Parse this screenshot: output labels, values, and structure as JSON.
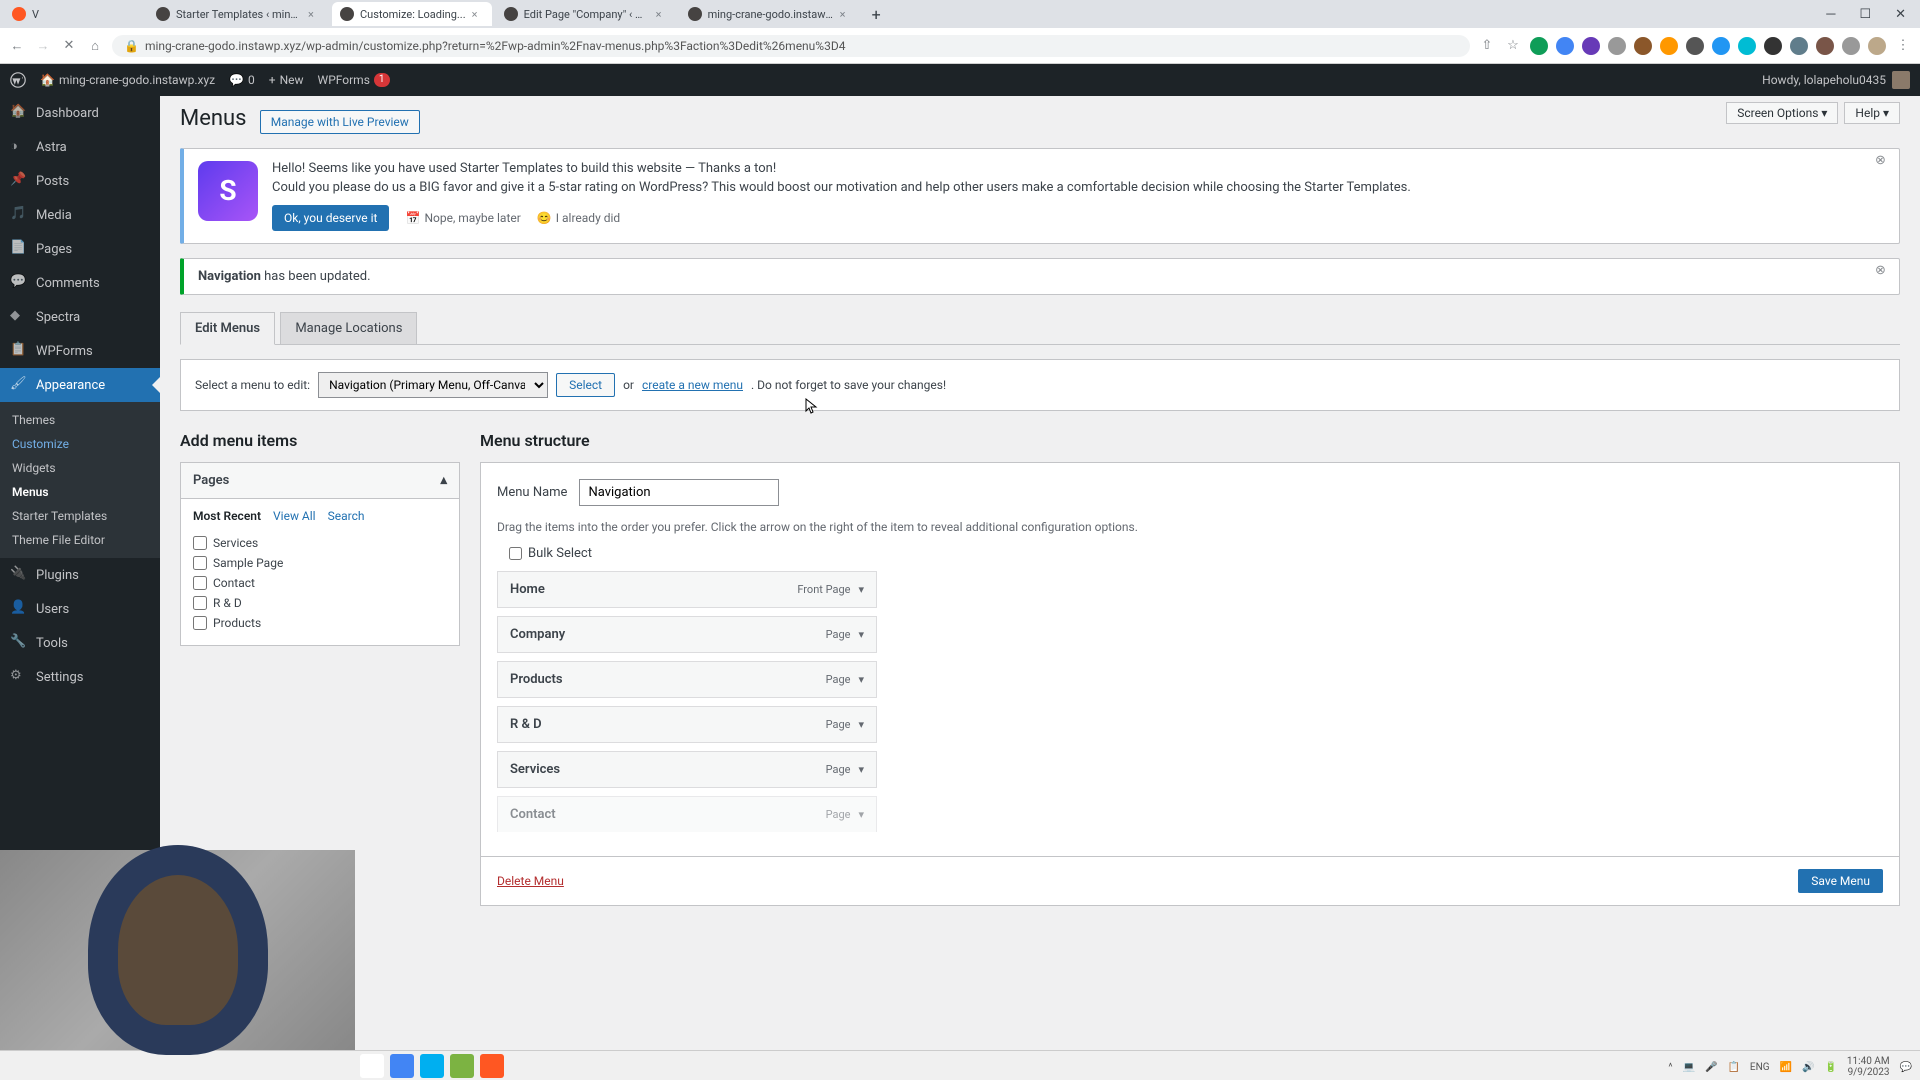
{
  "browser": {
    "tabs": [
      {
        "title": "Starter Templates ‹ ming-crane-g"
      },
      {
        "title": "Customize: Loading..."
      },
      {
        "title": "Edit Page \"Company\" ‹ ming-cra"
      },
      {
        "title": "ming-crane-godo.instawp.xyz"
      }
    ],
    "url": "ming-crane-godo.instawp.xyz/wp-admin/customize.php?return=%2Fwp-admin%2Fnav-menus.php%3Faction%3Dedit%26menu%3D4"
  },
  "adminbar": {
    "site": "ming-crane-godo.instawp.xyz",
    "comments": "0",
    "new": "New",
    "wpforms": "WPForms",
    "wpforms_count": "1",
    "howdy": "Howdy, lolapeholu0435"
  },
  "sidebar": {
    "items": [
      "Dashboard",
      "Astra",
      "Posts",
      "Media",
      "Pages",
      "Comments",
      "Spectra",
      "WPForms",
      "Appearance",
      "Plugins",
      "Users",
      "Tools",
      "Settings"
    ],
    "appearance_sub": [
      "Themes",
      "Customize",
      "Widgets",
      "Menus",
      "Starter Templates",
      "Theme File Editor"
    ]
  },
  "page": {
    "title": "Menus",
    "manage_preview": "Manage with Live Preview",
    "screen_options": "Screen Options",
    "help": "Help"
  },
  "st_notice": {
    "line1": "Hello! Seems like you have used Starter Templates to build this website — Thanks a ton!",
    "line2": "Could you please do us a BIG favor and give it a 5-star rating on WordPress? This would boost our motivation and help other users make a comfortable decision while choosing the Starter Templates.",
    "btn_ok": "Ok, you deserve it",
    "btn_later": "Nope, maybe later",
    "btn_already": "I already did"
  },
  "update_notice": {
    "strong": "Navigation",
    "text": " has been updated."
  },
  "tabs": {
    "edit": "Edit Menus",
    "manage": "Manage Locations"
  },
  "selector": {
    "label": "Select a menu to edit:",
    "value": "Navigation (Primary Menu, Off-Canvas Menu)",
    "select_btn": "Select",
    "or": "or",
    "create": "create a new menu",
    "dont_forget": ". Do not forget to save your changes!"
  },
  "add_items": {
    "heading": "Add menu items",
    "section": "Pages",
    "tabs": [
      "Most Recent",
      "View All",
      "Search"
    ],
    "pages": [
      "Services",
      "Sample Page",
      "Contact",
      "R & D",
      "Products"
    ]
  },
  "structure": {
    "heading": "Menu structure",
    "name_label": "Menu Name",
    "name_value": "Navigation",
    "hint": "Drag the items into the order you prefer. Click the arrow on the right of the item to reveal additional configuration options.",
    "bulk": "Bulk Select",
    "items": [
      {
        "title": "Home",
        "type": "Front Page"
      },
      {
        "title": "Company",
        "type": "Page"
      },
      {
        "title": "Products",
        "type": "Page"
      },
      {
        "title": "R & D",
        "type": "Page"
      },
      {
        "title": "Services",
        "type": "Page"
      },
      {
        "title": "Contact",
        "type": "Page"
      }
    ],
    "delete": "Delete Menu",
    "save": "Save Menu"
  },
  "tray": {
    "lang": "ENG",
    "time": "11:40 AM",
    "date": "9/9/2023"
  }
}
